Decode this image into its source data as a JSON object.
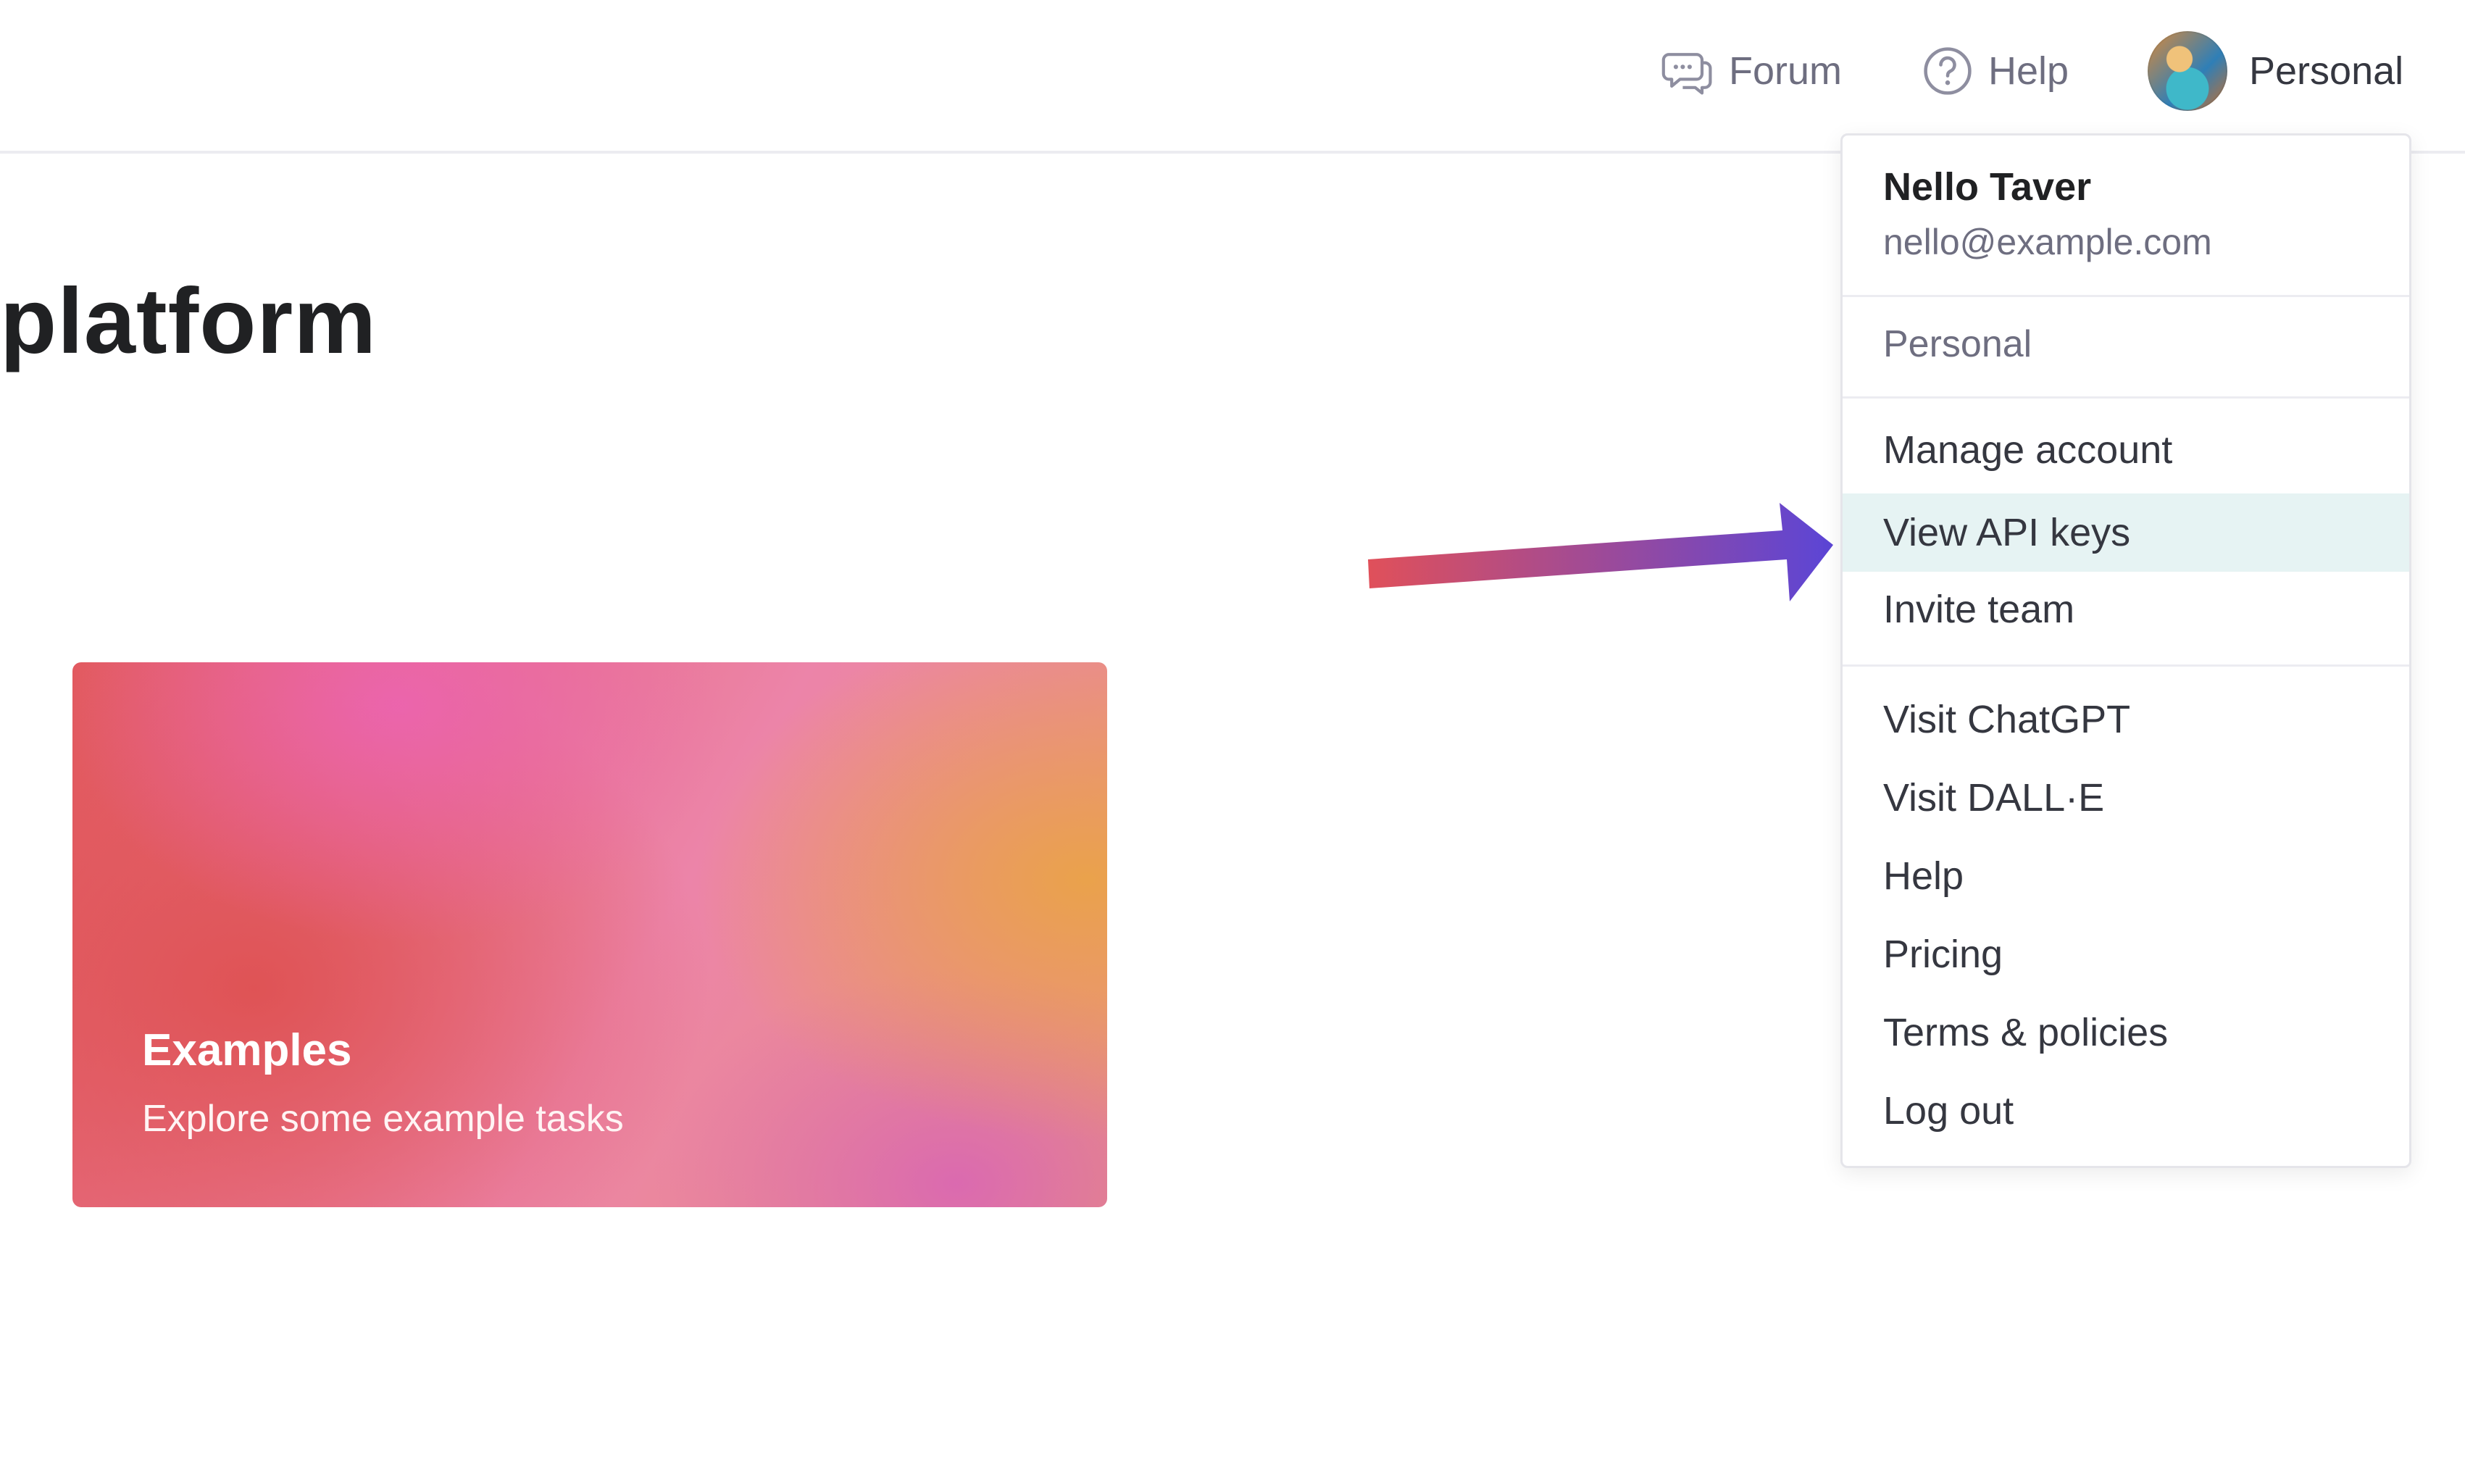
{
  "header": {
    "forum_label": "Forum",
    "help_label": "Help",
    "account_label": "Personal"
  },
  "main": {
    "title": "platform",
    "card": {
      "title": "Examples",
      "subtitle": "Explore some example tasks"
    }
  },
  "account_menu": {
    "user_name": "Nello Taver",
    "user_email": "nello@example.com",
    "organization": "Personal",
    "items": [
      {
        "label": "Manage account"
      },
      {
        "label": "View API keys",
        "highlighted": true
      },
      {
        "label": "Invite team"
      },
      {
        "label": "Visit ChatGPT"
      },
      {
        "label": "Visit DALL·E"
      },
      {
        "label": "Help"
      },
      {
        "label": "Pricing"
      },
      {
        "label": "Terms & policies"
      },
      {
        "label": "Log out"
      }
    ]
  },
  "annotation": {
    "arrow_gradient": [
      "#e0505a",
      "#5b45d6"
    ]
  }
}
